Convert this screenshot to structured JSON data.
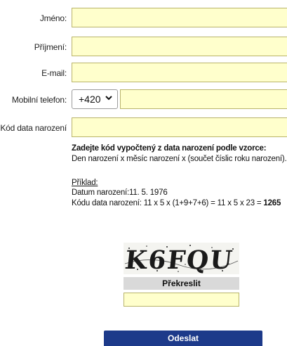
{
  "form": {
    "first_name_label": "Jméno:",
    "last_name_label": "Příjmení:",
    "email_label": "E-mail:",
    "mobile_label": "Mobilní telefon:",
    "phone_prefix": "+420",
    "birth_code_label": "Kód data narození"
  },
  "instructions": {
    "heading": "Zadejte kód vypočtený z data narození podle vzorce:",
    "formula": "Den narození x měsíc narození x (součet číslic roku narození).",
    "example_label": "Příklad:",
    "example_date": "Datum narození:11. 5. 1976",
    "example_calc": "Kódu data narození: 11 x 5 x (1+9+7+6) = 11 x 5 x 23 = ",
    "example_result": "1265"
  },
  "captcha": {
    "text": "K6FQU",
    "redraw_label": "Překreslit"
  },
  "submit_label": "Odeslat",
  "colors": {
    "field_bg": "#ffffcc",
    "submit_bg": "#1d3a8a"
  }
}
